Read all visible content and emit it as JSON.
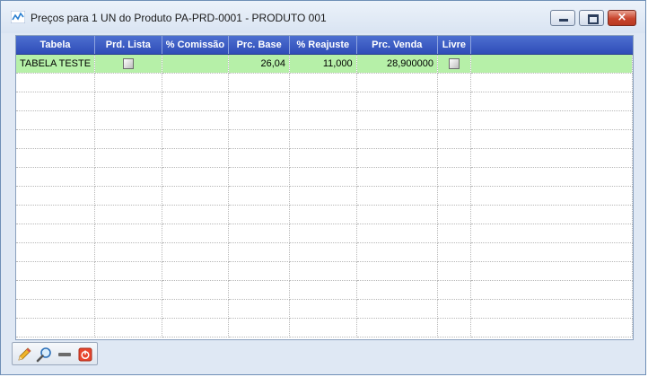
{
  "window": {
    "title": "Preços para 1 UN do Produto PA-PRD-0001 - PRODUTO 001",
    "controls": {
      "minimize": "minimize",
      "maximize": "maximize",
      "close": "×"
    }
  },
  "grid": {
    "columns": [
      "Tabela",
      "Prd. Lista",
      "% Comissão",
      "Prc. Base",
      "% Reajuste",
      "Prc. Venda",
      "Livre"
    ],
    "rows": [
      {
        "tabela": "TABELA TESTE",
        "prd_lista": false,
        "comissao": "",
        "prc_base": "26,04",
        "reajuste": "11,000",
        "prc_venda": "28,900000",
        "livre": false
      }
    ],
    "empty_rows": 14,
    "colors": {
      "header": "#3a5cc4",
      "selected_row": "#b6f0a8"
    }
  },
  "toolbar": {
    "buttons": [
      {
        "name": "edit",
        "icon": "pencil-icon"
      },
      {
        "name": "search",
        "icon": "magnifier-icon"
      },
      {
        "name": "remove",
        "icon": "minus-icon"
      },
      {
        "name": "power",
        "icon": "power-icon"
      }
    ]
  }
}
